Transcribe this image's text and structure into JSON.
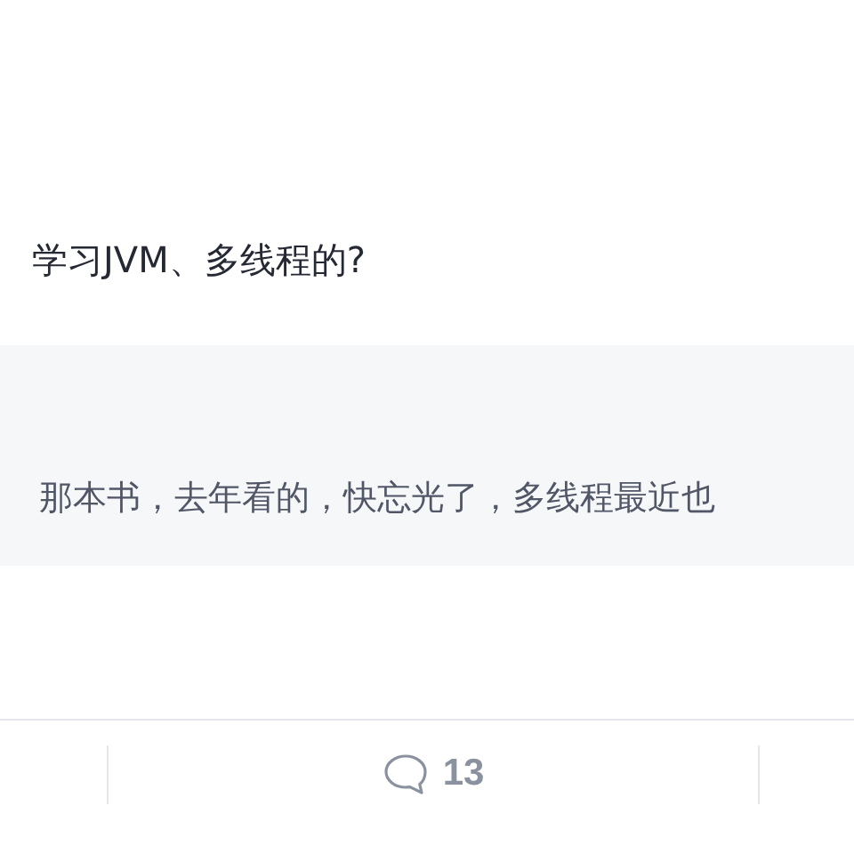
{
  "post": {
    "question": "学习JVM、多线程的?"
  },
  "quote": {
    "text": "那本书，去年看的，快忘光了，多线程最近也"
  },
  "actions": {
    "comment_count": "13"
  }
}
